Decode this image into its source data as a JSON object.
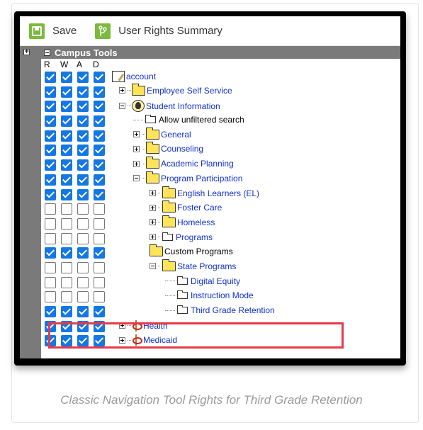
{
  "toolbar": {
    "save_label": "Save",
    "summary_label": "User Rights Summary"
  },
  "panel": {
    "header_title": "Campus Tools",
    "columns": [
      "R",
      "W",
      "A",
      "D"
    ]
  },
  "tree": [
    {
      "label": "account",
      "level": 0,
      "icon": "account-icon",
      "expander": "none",
      "checks": [
        true,
        true,
        true,
        true
      ],
      "style": "link"
    },
    {
      "label": "Employee Self Service",
      "level": 1,
      "icon": "folder-icon",
      "expander": "plus",
      "checks": [
        true,
        true,
        true,
        true
      ],
      "style": "link"
    },
    {
      "label": "Student Information",
      "level": 1,
      "icon": "student-icon",
      "expander": "minus",
      "checks": [
        true,
        true,
        true,
        true
      ],
      "style": "link"
    },
    {
      "label": "Allow unfiltered search",
      "level": 2,
      "icon": "page-icon",
      "expander": "dash",
      "checks": [
        true,
        true,
        true,
        true
      ],
      "style": "plain"
    },
    {
      "label": "General",
      "level": 2,
      "icon": "folder-icon",
      "expander": "plus",
      "checks": [
        true,
        true,
        true,
        true
      ],
      "style": "link"
    },
    {
      "label": "Counseling",
      "level": 2,
      "icon": "folder-icon",
      "expander": "plus",
      "checks": [
        true,
        true,
        true,
        true
      ],
      "style": "link"
    },
    {
      "label": "Academic Planning",
      "level": 2,
      "icon": "folder-icon",
      "expander": "plus",
      "checks": [
        true,
        true,
        true,
        true
      ],
      "style": "link"
    },
    {
      "label": "Program Participation",
      "level": 2,
      "icon": "folder-icon",
      "expander": "minus",
      "checks": [
        true,
        true,
        true,
        true
      ],
      "style": "link"
    },
    {
      "label": "English Learners (EL)",
      "level": 3,
      "icon": "folder-icon",
      "expander": "plus",
      "checks": [
        true,
        true,
        true,
        true
      ],
      "style": "link"
    },
    {
      "label": "Foster Care",
      "level": 3,
      "icon": "folder-icon",
      "expander": "plus",
      "checks": [
        false,
        false,
        false,
        false
      ],
      "style": "link"
    },
    {
      "label": "Homeless",
      "level": 3,
      "icon": "folder-icon",
      "expander": "plus",
      "checks": [
        false,
        false,
        false,
        false
      ],
      "style": "link"
    },
    {
      "label": "Programs",
      "level": 3,
      "icon": "page-icon",
      "expander": "plus",
      "checks": [
        false,
        false,
        false,
        false
      ],
      "style": "link"
    },
    {
      "label": "Custom Programs",
      "level": 3,
      "icon": "folder-icon",
      "expander": "none",
      "checks": [
        true,
        true,
        true,
        true
      ],
      "style": "plain"
    },
    {
      "label": "State Programs",
      "level": 3,
      "icon": "folder-icon",
      "expander": "minus",
      "checks": [
        false,
        false,
        false,
        false
      ],
      "style": "link"
    },
    {
      "label": "Digital Equity",
      "level": 4,
      "icon": "page-icon",
      "expander": "dash",
      "checks": [
        false,
        false,
        false,
        false
      ],
      "style": "link"
    },
    {
      "label": "Instruction Mode",
      "level": 4,
      "icon": "page-icon",
      "expander": "dash",
      "checks": [
        false,
        false,
        false,
        false
      ],
      "style": "link"
    },
    {
      "label": "Third Grade Retention",
      "level": 4,
      "icon": "page-icon",
      "expander": "dash",
      "checks": [
        true,
        true,
        true,
        true
      ],
      "style": "link"
    },
    {
      "label": "Health",
      "level": 1,
      "icon": "caduceus-icon",
      "expander": "plus",
      "checks": [
        true,
        true,
        true,
        true
      ],
      "style": "link"
    },
    {
      "label": "Medicaid",
      "level": 1,
      "icon": "caduceus-icon",
      "expander": "plus",
      "checks": [
        true,
        true,
        true,
        true
      ],
      "style": "link"
    }
  ],
  "highlight_label": "Third Grade Retention",
  "caption": "Classic Navigation Tool Rights for Third Grade Retention",
  "colors": {
    "checkbox_checked": "#1577e4",
    "toolbar_icon": "#7cb93f",
    "panel_grey": "#7a7a7a",
    "highlight": "#e8384a",
    "link": "#1030cc"
  }
}
